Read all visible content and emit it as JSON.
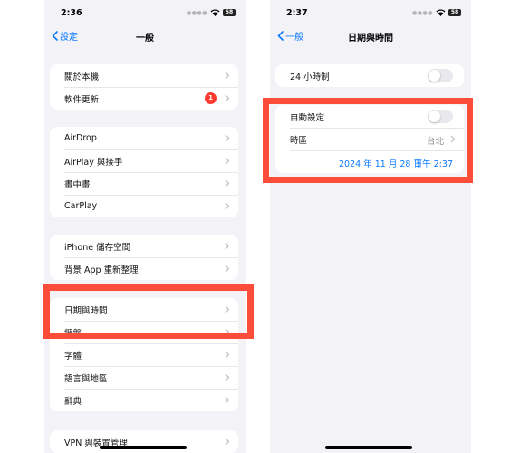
{
  "left_screen": {
    "status_time": "2:36",
    "battery": "58",
    "back_label": "設定",
    "title": "一般",
    "group1": [
      {
        "label": "關於本機"
      },
      {
        "label": "軟件更新",
        "badge": "1"
      }
    ],
    "group2": [
      {
        "label": "AirDrop"
      },
      {
        "label": "AirPlay 與接手"
      },
      {
        "label": "畫中畫"
      },
      {
        "label": "CarPlay"
      }
    ],
    "group3": [
      {
        "label": "iPhone 儲存空間"
      },
      {
        "label": "背景 App 重新整理"
      }
    ],
    "group4": [
      {
        "label": "日期與時間"
      },
      {
        "label": "鍵盤"
      },
      {
        "label": "字體"
      },
      {
        "label": "語言與地區"
      },
      {
        "label": "辭典"
      }
    ],
    "group5": [
      {
        "label": "VPN 與裝置管理"
      }
    ]
  },
  "right_screen": {
    "status_time": "2:37",
    "battery": "58",
    "back_label": "一般",
    "title": "日期與時間",
    "toggle_24h": {
      "label": "24 小時制",
      "on": false
    },
    "auto_set": {
      "label": "自動設定",
      "on": false
    },
    "timezone": {
      "label": "時區",
      "value": "台北"
    },
    "date_value": "2024 年 11 月 28 日",
    "time_value": "下午 2:37"
  },
  "colors": {
    "accent": "#0a7aff",
    "highlight": "#fb4d3a",
    "badge": "#ff3b30",
    "background": "#f2f2f7"
  }
}
